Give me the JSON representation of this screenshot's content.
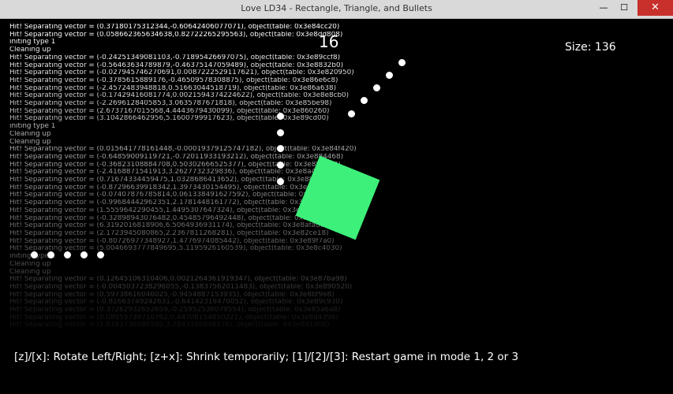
{
  "window": {
    "title": "Love LD34 - Rectangle, Triangle, and Bullets",
    "minimize_glyph": "—",
    "maximize_glyph": "☐",
    "close_glyph": "✕"
  },
  "hud": {
    "score": "16",
    "size": "Size: 136",
    "controls": "[z]/[x]: Rotate Left/Right; [z+x]: Shrink temporarily; [1]/[2]/[3]: Restart game in mode 1, 2 or 3"
  },
  "colors": {
    "square": "#3cf07a",
    "close_button": "#c7302b"
  },
  "log": [
    "Hit! Separating vector = (0.37180175312344,-0.60642406077071), object(table: 0x3e84cc20)",
    "Hit! Separating vector = (0.058662365634638,0.82722265295563), object(table: 0x3e8dd808)",
    "initing type 1",
    "Cleaning up",
    "Hit! Separating vector = (-0.24251349081103,-0.71895426697075), object(table: 0x3e89ccf8)",
    "Hit! Separating vector = (-0.56463634789879,-0.46375147059489), object(table: 0x3e8832b0)",
    "Hit! Separating vector = (-0.027945746270691,0.0087222529117621), object(table: 0x3e820950)",
    "Hit! Separating vector = (-0.3785615889176,-0.46509578308875), object(table: 0x3e86e6c8)",
    "Hit! Separating vector = (-2.4572483948818,0.51663044518719), object(table: 0x3e86a638)",
    "Hit! Separating vector = (-0.17429416081774,0.0021594374224622), object(table: 0x3e8e8cb0)",
    "Hit! Separating vector = (-2.2696128405853,3.0635787671818), object(table: 0x3e85be98)",
    "Hit! Separating vector = (2.6737167015568,4.4443679430099), object(table: 0x3e860260)",
    "Hit! Separating vector = (3.1042866462956,5.1600799917623), object(table: 0x3e89cd00)",
    "initing type 1",
    "Cleaning up",
    "Cleaning up",
    "Hit! Separating vector = (0.015641778161448,-0.00019379125747182), object(table: 0x3e84f420)",
    "Hit! Separating vector = (-0.64859009119721,-0.72011933193212), object(table: 0x3e884468)",
    "Hit! Separating vector = (-0.36823108884708,0.50302666525377), object(table: 0x3e8b9a68)",
    "Hit! Separating vector = (-2.4168871541913,3.2627732329836), object(table: 0x3e8a44f8)",
    "Hit! Separating vector = (0.71674334459475,1.0328686413652), object(table: 0x3e88c9c8)",
    "Hit! Separating vector = (-0.87296639918342,1.3973430154495), object(table: 0x3e881180)",
    "Hit! Separating vector = (-0.07407876785814,0.061338491627592), object(table: 0x3e89fda8)",
    "Hit! Separating vector = (-0.99684442962351,2.1781448161772), object(table: 0x3e86d2d0)",
    "Hit! Separating vector = (1.5559642290455,1.4495307647324), object(table: 0x3e866190)",
    "Hit! Separating vector = (-0.32898943076482,0.45485796492448), object(table: 0x3e8c65b8)",
    "Hit! Separating vector = (6.3192016818906,6.5064936931174), object(table: 0x3e8afad0)",
    "Hit! Separating vector = (2.1723945080865,2.2367811268281), object(table: 0x3e82ce18)",
    "Hit! Separating vector = (-0.80726977348927,1.4776974085442), object(table: 0x3e89f7a0)",
    "Hit! Separating vector = (5.0046693777849695,5.1195926160539), object(table: 0x3e8c4030)",
    "initing type 1",
    "Cleaning up",
    "Cleaning up",
    "Hit! Separating vector = (0.12645106310406,0.0021264361919347), object(table: 0x3e87ba98)",
    "Hit! Separating vector = (-0.0045037238296055,-0.13837562011483), object(table: 0x3e890520)",
    "Hit! Separating vector = (0.59738616046025,-0.9454887153935), object(table: 0x3e8bf9e8)",
    "Hit! Separating vector = (-0.81663749242631,-0.64142319470052), object(table: 0x3e89c930)",
    "Hit! Separating vector = (0.37262932652659,-0.25952536079554), object(table: 0x3e85a6a8)",
    "Hit! Separating vector = (0.08559739710762,0.44708154850221), object(table: 0x3e8d4398)",
    "Hit! Separating vector = (1.8161736980505,3.7843106948576), object(table: 0x3e8d1d00)"
  ]
}
